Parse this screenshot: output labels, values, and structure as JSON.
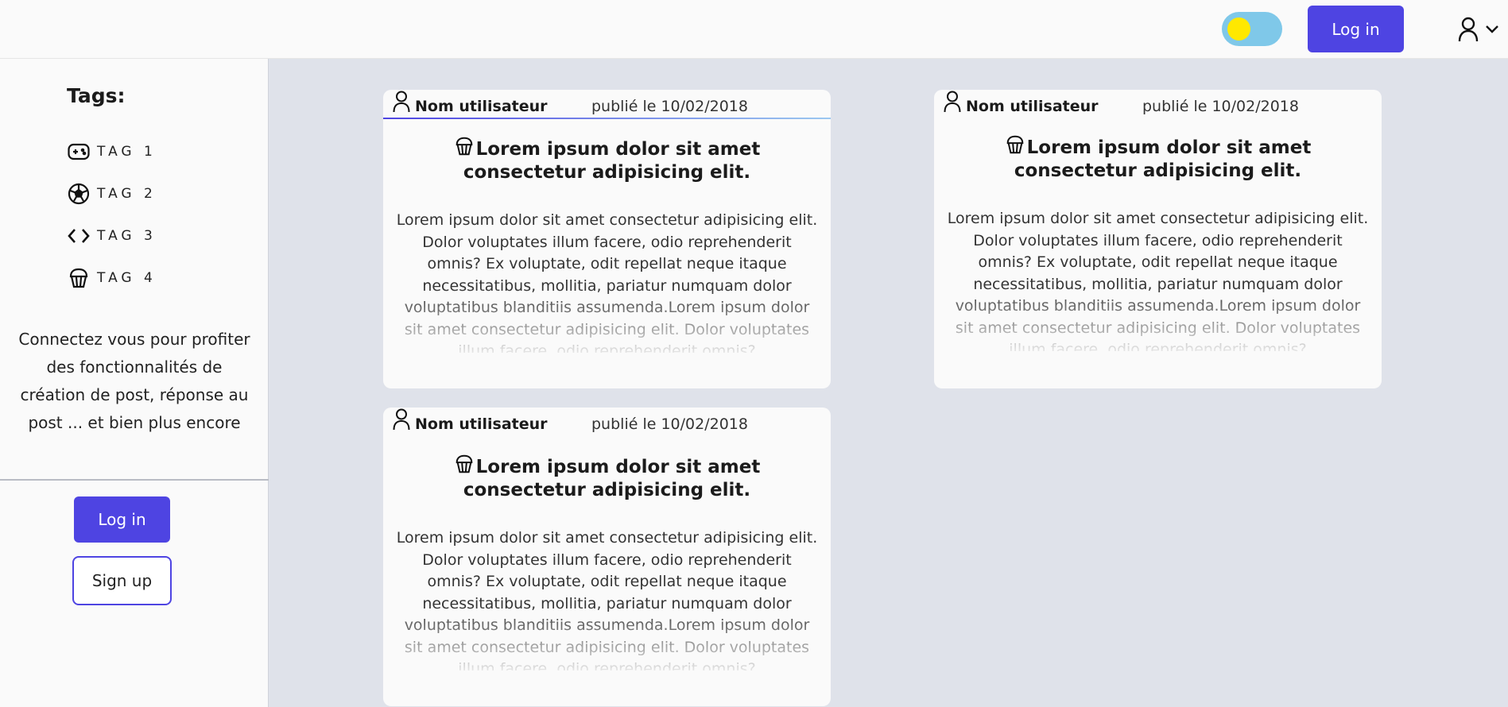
{
  "header": {
    "login_label": "Log in"
  },
  "sidebar": {
    "tags_title": "Tags:",
    "tags": [
      {
        "label": "TAG 1",
        "icon": "gamepad-icon"
      },
      {
        "label": "TAG 2",
        "icon": "soccer-ball-icon"
      },
      {
        "label": "TAG 3",
        "icon": "code-icon"
      },
      {
        "label": "TAG 4",
        "icon": "cupcake-icon"
      }
    ],
    "connect_text": "Connectez vous pour profiter des fonctionnalités de création de post, réponse au post ... et bien plus encore",
    "login_label": "Log in",
    "signup_label": "Sign up"
  },
  "posts": [
    {
      "user": "Nom utilisateur",
      "date": "publié le 10/02/2018",
      "title": "Lorem ipsum dolor sit amet consectetur adipisicing elit.",
      "body": "Lorem ipsum dolor sit amet consectetur adipisicing elit. Dolor voluptates illum facere, odio reprehenderit omnis? Ex voluptate, odit repellat neque itaque necessitatibus, mollitia, pariatur numquam dolor voluptatibus blanditiis assumenda.Lorem ipsum dolor sit amet consectetur adipisicing elit. Dolor voluptates illum facere, odio reprehenderit omnis?"
    },
    {
      "user": "Nom utilisateur",
      "date": "publié le 10/02/2018",
      "title": "Lorem ipsum dolor sit amet consectetur adipisicing elit.",
      "body": "Lorem ipsum dolor sit amet consectetur adipisicing elit. Dolor voluptates illum facere, odio reprehenderit omnis? Ex voluptate, odit repellat neque itaque necessitatibus, mollitia, pariatur numquam dolor voluptatibus blanditiis assumenda.Lorem ipsum dolor sit amet consectetur adipisicing elit. Dolor voluptates illum facere, odio reprehenderit omnis?"
    },
    {
      "user": "Nom utilisateur",
      "date": "publié le 10/02/2018",
      "title": "Lorem ipsum dolor sit amet consectetur adipisicing elit.",
      "body": "Lorem ipsum dolor sit amet consectetur adipisicing elit. Dolor voluptates illum facere, odio reprehenderit omnis? Ex voluptate, odit repellat neque itaque necessitatibus, mollitia, pariatur numquam dolor voluptatibus blanditiis assumenda.Lorem ipsum dolor sit amet consectetur adipisicing elit. Dolor voluptates illum facere, odio reprehenderit omnis?"
    }
  ],
  "colors": {
    "accent": "#4e44e2",
    "toggle_track": "#7fc8e9",
    "toggle_knob": "#ffe800",
    "main_bg": "#dfe2ea",
    "panel_bg": "#fafafa"
  }
}
